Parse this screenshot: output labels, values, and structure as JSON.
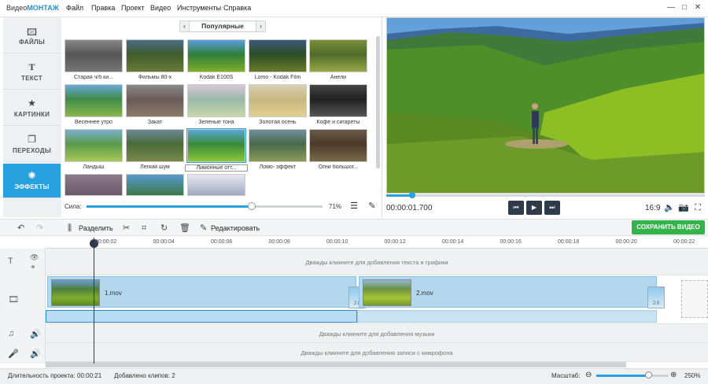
{
  "app": {
    "title_prefix": "Видео",
    "title_brand": "МОНТАЖ",
    "minimize": "—",
    "maximize": "□",
    "close": "✕"
  },
  "menu": [
    "Файл",
    "Правка",
    "Проект",
    "Видео",
    "Инструменты",
    "Справка"
  ],
  "nav": [
    {
      "label": "ФАЙЛЫ",
      "icon": "image-icon"
    },
    {
      "label": "ТЕКСТ",
      "icon": "text-t-icon"
    },
    {
      "label": "КАРТИНКИ",
      "icon": "star-icon"
    },
    {
      "label": "ПЕРЕХОДЫ",
      "icon": "transitions-icon"
    },
    {
      "label": "ЭФФЕКТЫ",
      "icon": "effects-wand-icon",
      "active": true
    }
  ],
  "effects": {
    "category": "Популярные",
    "items": [
      {
        "label": "Старая ч/б ки..."
      },
      {
        "label": "Фильмы 80-х"
      },
      {
        "label": "Kodak E100S"
      },
      {
        "label": "Lomo - Kodak Film"
      },
      {
        "label": "Анели"
      },
      {
        "label": "Весеннее утро"
      },
      {
        "label": "Закат"
      },
      {
        "label": "Зеленые тона"
      },
      {
        "label": "Золотая осень"
      },
      {
        "label": "Кофе и сигареты"
      },
      {
        "label": "Ландыш"
      },
      {
        "label": "Легкий шум"
      },
      {
        "label": "Лимонные отт...",
        "selected": true
      },
      {
        "label": "Ломо- эффект"
      },
      {
        "label": "Огни большог..."
      },
      {
        "label": ""
      },
      {
        "label": ""
      },
      {
        "label": ""
      }
    ],
    "strength_label": "Сила:",
    "strength_value": "71%",
    "strength_fraction": 0.71
  },
  "preview": {
    "timecode": "00:00:01.700",
    "aspect": "16:9",
    "progress_fraction": 0.08
  },
  "toolbar": {
    "split": "Разделить",
    "edit": "Редактировать",
    "save": "СОХРАНИТЬ ВИДЕО"
  },
  "ruler": [
    "00:00:02",
    "00:00:04",
    "00:00:06",
    "00:00:08",
    "00:00:10",
    "00:00:12",
    "00:00:14",
    "00:00:16",
    "00:00:18",
    "00:00:20",
    "00:00:22"
  ],
  "timeline": {
    "text_hint": "Дважды кликните для добавления текста и графики",
    "music_hint": "Дважды кликните для добавления музыки",
    "mic_hint": "Дважды кликните для добавления записи с микрофона",
    "clip1": "1.mov",
    "clip2": "2.mov",
    "transition_duration": "2.0"
  },
  "status": {
    "duration_label": "Длительность проекта:",
    "duration": "00:00:21",
    "clips": "Добавлено клипов: 2",
    "zoom_label": "Масштаб:",
    "zoom_value": "250%"
  }
}
